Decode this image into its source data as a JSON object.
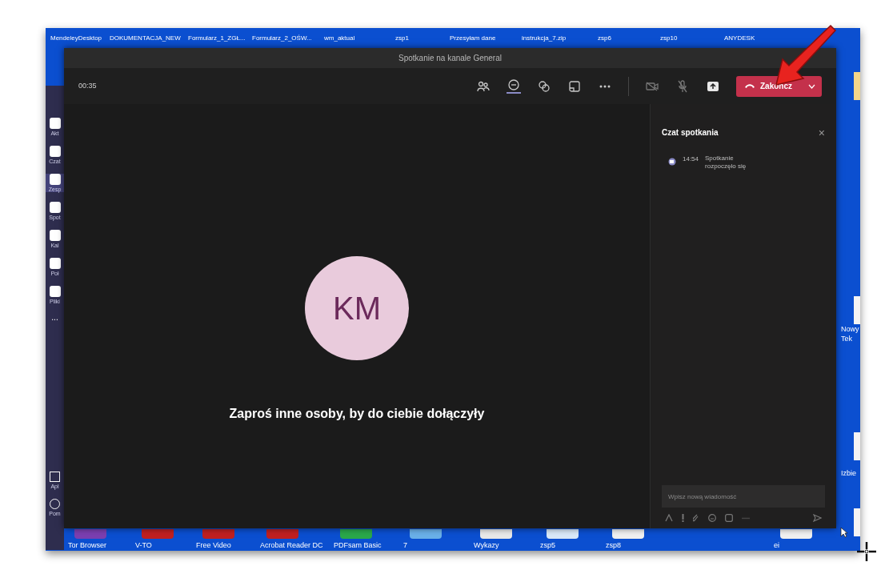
{
  "desktop": {
    "top_icons": [
      "MendeleyDesktop",
      "DOKUMENTACJA_NEW",
      "Formularz_1_ZGŁ...",
      "Formularz_2_OŚW...",
      "wm_aktual",
      "zsp1",
      "Przesyłam dane",
      "instrukcja_7.zip",
      "zsp6",
      "zsp10",
      "ANYDESK"
    ],
    "bottom_icons": [
      "Tor Browser",
      "V-TO",
      "Free Video",
      "Acrobat Reader DC",
      "PDFsam Basic",
      "7",
      "Wykazy",
      "zsp5",
      "zsp8",
      "ei"
    ],
    "right_icons": [
      "Nowy",
      "Tek",
      "Izbie"
    ]
  },
  "sidebar": {
    "items": [
      {
        "label": "Akt",
        "selected": false
      },
      {
        "label": "Czat",
        "selected": false
      },
      {
        "label": "Zesp",
        "selected": true
      },
      {
        "label": "Spot",
        "selected": false
      },
      {
        "label": "Kal",
        "selected": false
      },
      {
        "label": "Poł",
        "selected": false
      },
      {
        "label": "Pliki",
        "selected": false
      }
    ],
    "more": "...",
    "bottom": [
      {
        "label": "Apl",
        "kind": "apps"
      },
      {
        "label": "Pom",
        "kind": "help"
      }
    ]
  },
  "meeting": {
    "title": "Spotkanie na kanale General",
    "timer": "00:35",
    "end_button": "Zakończ",
    "avatar_initials": "KM",
    "invite_text": "Zaproś inne osoby, by do ciebie dołączyły"
  },
  "chat": {
    "title": "Czat spotkania",
    "close": "×",
    "messages": [
      {
        "time": "14:54",
        "text": "Spotkanie rozpoczęło się"
      }
    ],
    "input": {
      "placeholder": "Wpisz nową wiadomość"
    }
  }
}
